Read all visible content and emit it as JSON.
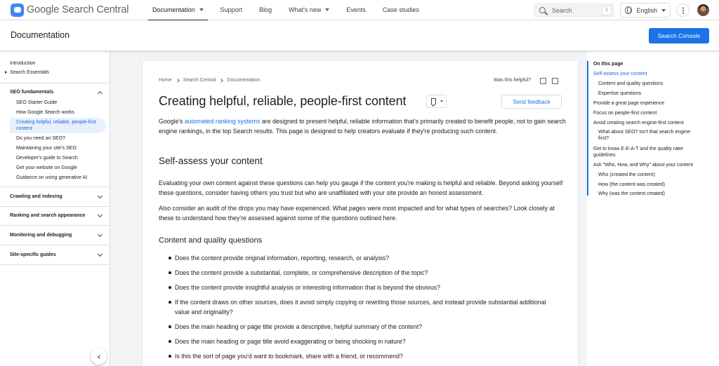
{
  "header": {
    "logo_text": "Google Search Central",
    "nav": [
      {
        "label": "Documentation",
        "has_menu": true
      },
      {
        "label": "Support",
        "has_menu": false
      },
      {
        "label": "Blog",
        "has_menu": false
      },
      {
        "label": "What's new",
        "has_menu": true
      },
      {
        "label": "Events",
        "has_menu": false
      },
      {
        "label": "Case studies",
        "has_menu": false
      }
    ],
    "search_placeholder": "Search",
    "search_shortcut": "/",
    "language": "English",
    "icons": {
      "search": "search-icon",
      "language": "globe-icon",
      "more": "more-vert-icon",
      "avatar": "user-avatar"
    }
  },
  "subheader": {
    "title": "Documentation",
    "console_button": "Search Console"
  },
  "leftnav": {
    "top_items": [
      "Introduction",
      "Search Essentials"
    ],
    "sections": [
      {
        "label": "SEO fundamentals",
        "expanded": true,
        "items": [
          "SEO Starter Guide",
          "How Google Search works",
          "Creating helpful, reliable, people-first content",
          "Do you need an SEO?",
          "Maintaining your site's SEO",
          "Developer's guide to Search",
          "Get your website on Google",
          "Guidance on using generative AI"
        ],
        "active_index": 2
      },
      {
        "label": "Crawling and indexing",
        "expanded": false
      },
      {
        "label": "Ranking and search appearance",
        "expanded": false
      },
      {
        "label": "Monitoring and debugging",
        "expanded": false
      },
      {
        "label": "Site-specific guides",
        "expanded": false
      }
    ]
  },
  "article": {
    "breadcrumbs": [
      "Home",
      "Search Central",
      "Documentation"
    ],
    "helpful_prompt": "Was this helpful?",
    "title": "Creating helpful, reliable, people-first content",
    "feedback_button": "Send feedback",
    "intro": {
      "before_link": "Google's ",
      "link_text": "automated ranking systems",
      "after_link": " are designed to present helpful, reliable information that's primarily created to benefit people, not to gain search engine rankings, in the top Search results. This page is designed to help creators evaluate if they're producing such content."
    },
    "h2_self_assess": "Self-assess your content",
    "p1": "Evaluating your own content against these questions can help you gauge if the content you're making is helpful and reliable. Beyond asking yourself these questions, consider having others you trust but who are unaffiliated with your site provide an honest assessment.",
    "p2": "Also consider an audit of the drops you may have experienced. What pages were most impacted and for what types of searches? Look closely at these to understand how they're assessed against some of the questions outlined here.",
    "h3_quality": "Content and quality questions",
    "questions": [
      "Does the content provide original information, reporting, research, or analysis?",
      "Does the content provide a substantial, complete, or comprehensive description of the topic?",
      "Does the content provide insightful analysis or interesting information that is beyond the obvious?",
      "If the content draws on other sources, does it avoid simply copying or rewriting those sources, and instead provide substantial additional value and originality?",
      "Does the main heading or page title provide a descriptive, helpful summary of the content?",
      "Does the main heading or page title avoid exaggerating or being shocking in nature?",
      "Is this the sort of page you'd want to bookmark, share with a friend, or recommend?"
    ]
  },
  "toc": {
    "heading": "On this page",
    "items": [
      {
        "label": "Self-assess your content",
        "level": 1,
        "active": true
      },
      {
        "label": "Content and quality questions",
        "level": 2
      },
      {
        "label": "Expertise questions",
        "level": 2
      },
      {
        "label": "Provide a great page experience",
        "level": 1
      },
      {
        "label": "Focus on people-first content",
        "level": 1
      },
      {
        "label": "Avoid creating search engine-first content",
        "level": 1
      },
      {
        "label": "What about SEO? Isn't that search engine-first?",
        "level": 2
      },
      {
        "label": "Get to know E-E-A-T and the quality rater guidelines",
        "level": 1
      },
      {
        "label": "Ask \"Who, How, and Why\" about your content",
        "level": 1
      },
      {
        "label": "Who (created the content)",
        "level": 2
      },
      {
        "label": "How (the content was created)",
        "level": 2
      },
      {
        "label": "Why (was the content created)",
        "level": 2
      }
    ]
  },
  "colors": {
    "accent": "#1a73e8",
    "active_bg": "#e8f0fe",
    "page_bg": "#f1f3f4"
  }
}
